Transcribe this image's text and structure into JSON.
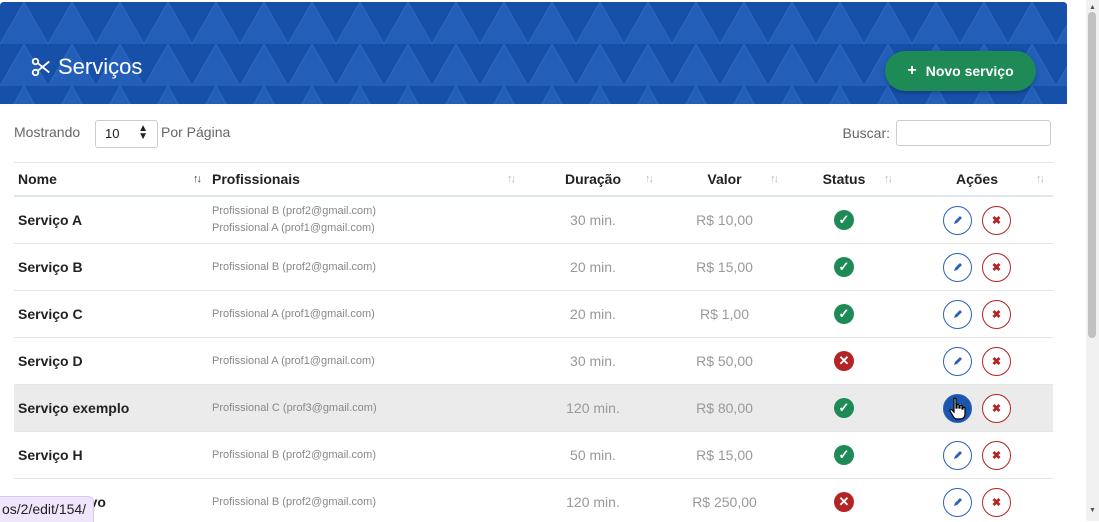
{
  "header": {
    "title": "Serviços",
    "title_icon": "scissors-icon",
    "new_button_label": "Novo serviço",
    "new_button_icon": "+"
  },
  "controls": {
    "showing_label": "Mostrando",
    "per_page_value": "10",
    "per_page_label": "Por Página",
    "search_label": "Buscar:",
    "search_value": ""
  },
  "table": {
    "columns": [
      "Nome",
      "Profissionais",
      "Duração",
      "Valor",
      "Status",
      "Ações"
    ],
    "rows": [
      {
        "name": "Serviço A",
        "prof1": "Profissional B (prof2@gmail.com)",
        "prof2": "Profissional A (prof1@gmail.com)",
        "duration": "30 min.",
        "value": "R$ 10,00",
        "status": "ok"
      },
      {
        "name": "Serviço B",
        "prof1": "Profissional B (prof2@gmail.com)",
        "prof2": "",
        "duration": "20 min.",
        "value": "R$ 15,00",
        "status": "ok"
      },
      {
        "name": "Serviço C",
        "prof1": "Profissional A (prof1@gmail.com)",
        "prof2": "",
        "duration": "20 min.",
        "value": "R$ 1,00",
        "status": "ok"
      },
      {
        "name": "Serviço D",
        "prof1": "Profissional A (prof1@gmail.com)",
        "prof2": "",
        "duration": "30 min.",
        "value": "R$ 50,00",
        "status": "inactive"
      },
      {
        "name": "Serviço exemplo",
        "prof1": "Profissional C (prof3@gmail.com)",
        "prof2": "",
        "duration": "120 min.",
        "value": "R$ 80,00",
        "status": "ok"
      },
      {
        "name": "Serviço H",
        "prof1": "Profissional B (prof2@gmail.com)",
        "prof2": "",
        "duration": "50 min.",
        "value": "R$ 15,00",
        "status": "ok"
      },
      {
        "name": "Serviço novo",
        "prof1": "Profissional B (prof2@gmail.com)",
        "prof2": "",
        "duration": "120 min.",
        "value": "R$ 250,00",
        "status": "inactive"
      }
    ]
  },
  "status_bar": {
    "url": "os/2/edit/154/"
  },
  "colors": {
    "header_bg": "#1a56b0",
    "primary_green": "#1e8a55",
    "danger_red": "#b32424",
    "edit_blue": "#2a63b8"
  }
}
